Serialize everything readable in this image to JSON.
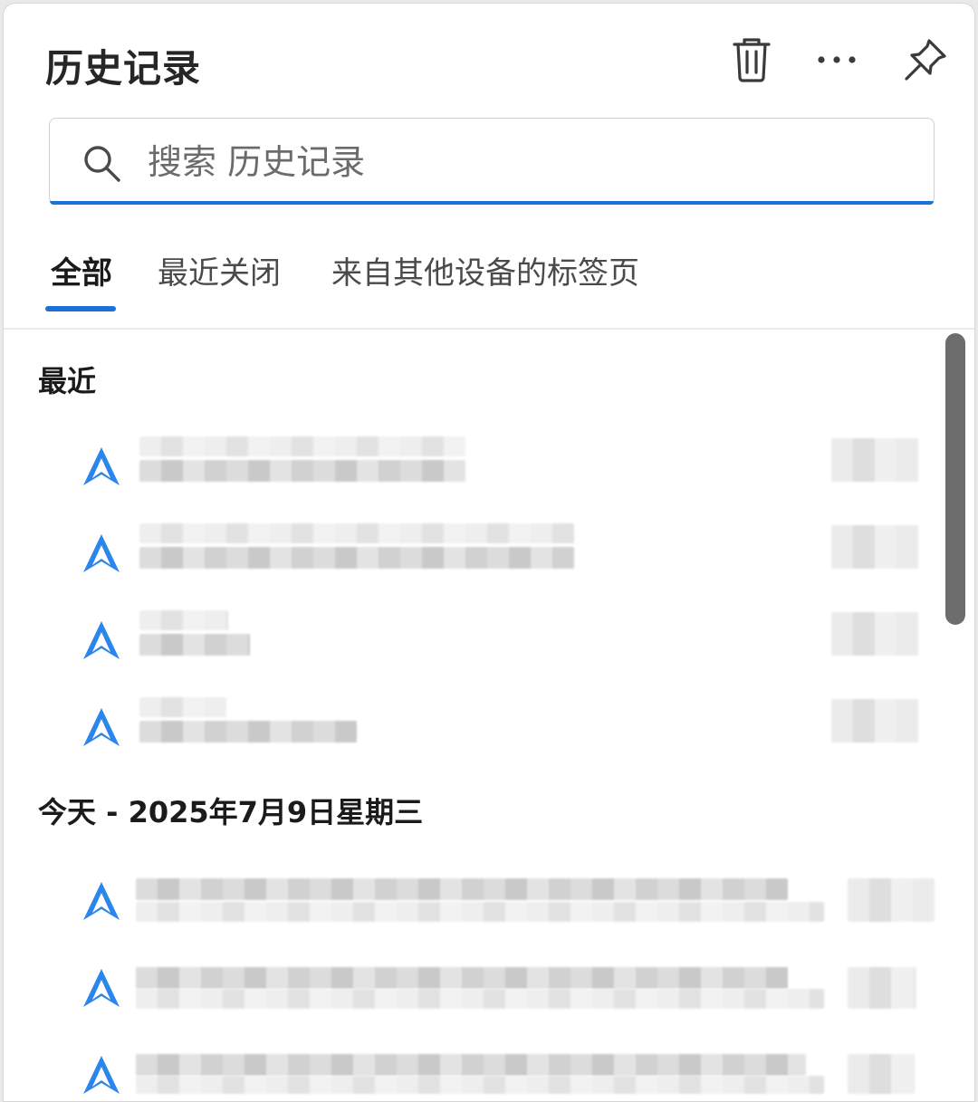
{
  "panel": {
    "title": "历史记录",
    "actions": {
      "delete_icon": "trash-icon",
      "more_icon": "more-horizontal-icon",
      "pin_icon": "pin-icon"
    }
  },
  "search": {
    "placeholder": "搜索 历史记录",
    "value": ""
  },
  "tabs": [
    {
      "label": "全部",
      "active": true
    },
    {
      "label": "最近关闭",
      "active": false
    },
    {
      "label": "来自其他设备的标签页",
      "active": false
    }
  ],
  "sections": [
    {
      "heading": "最近",
      "item_count": 4,
      "favicon": "site-logo-icon"
    },
    {
      "heading": "今天 - 2025年7月9日星期三",
      "item_count": 3,
      "favicon": "site-logo-icon"
    }
  ],
  "colors": {
    "accent": "#1f6fd8",
    "favicon": "#2a86e8"
  }
}
